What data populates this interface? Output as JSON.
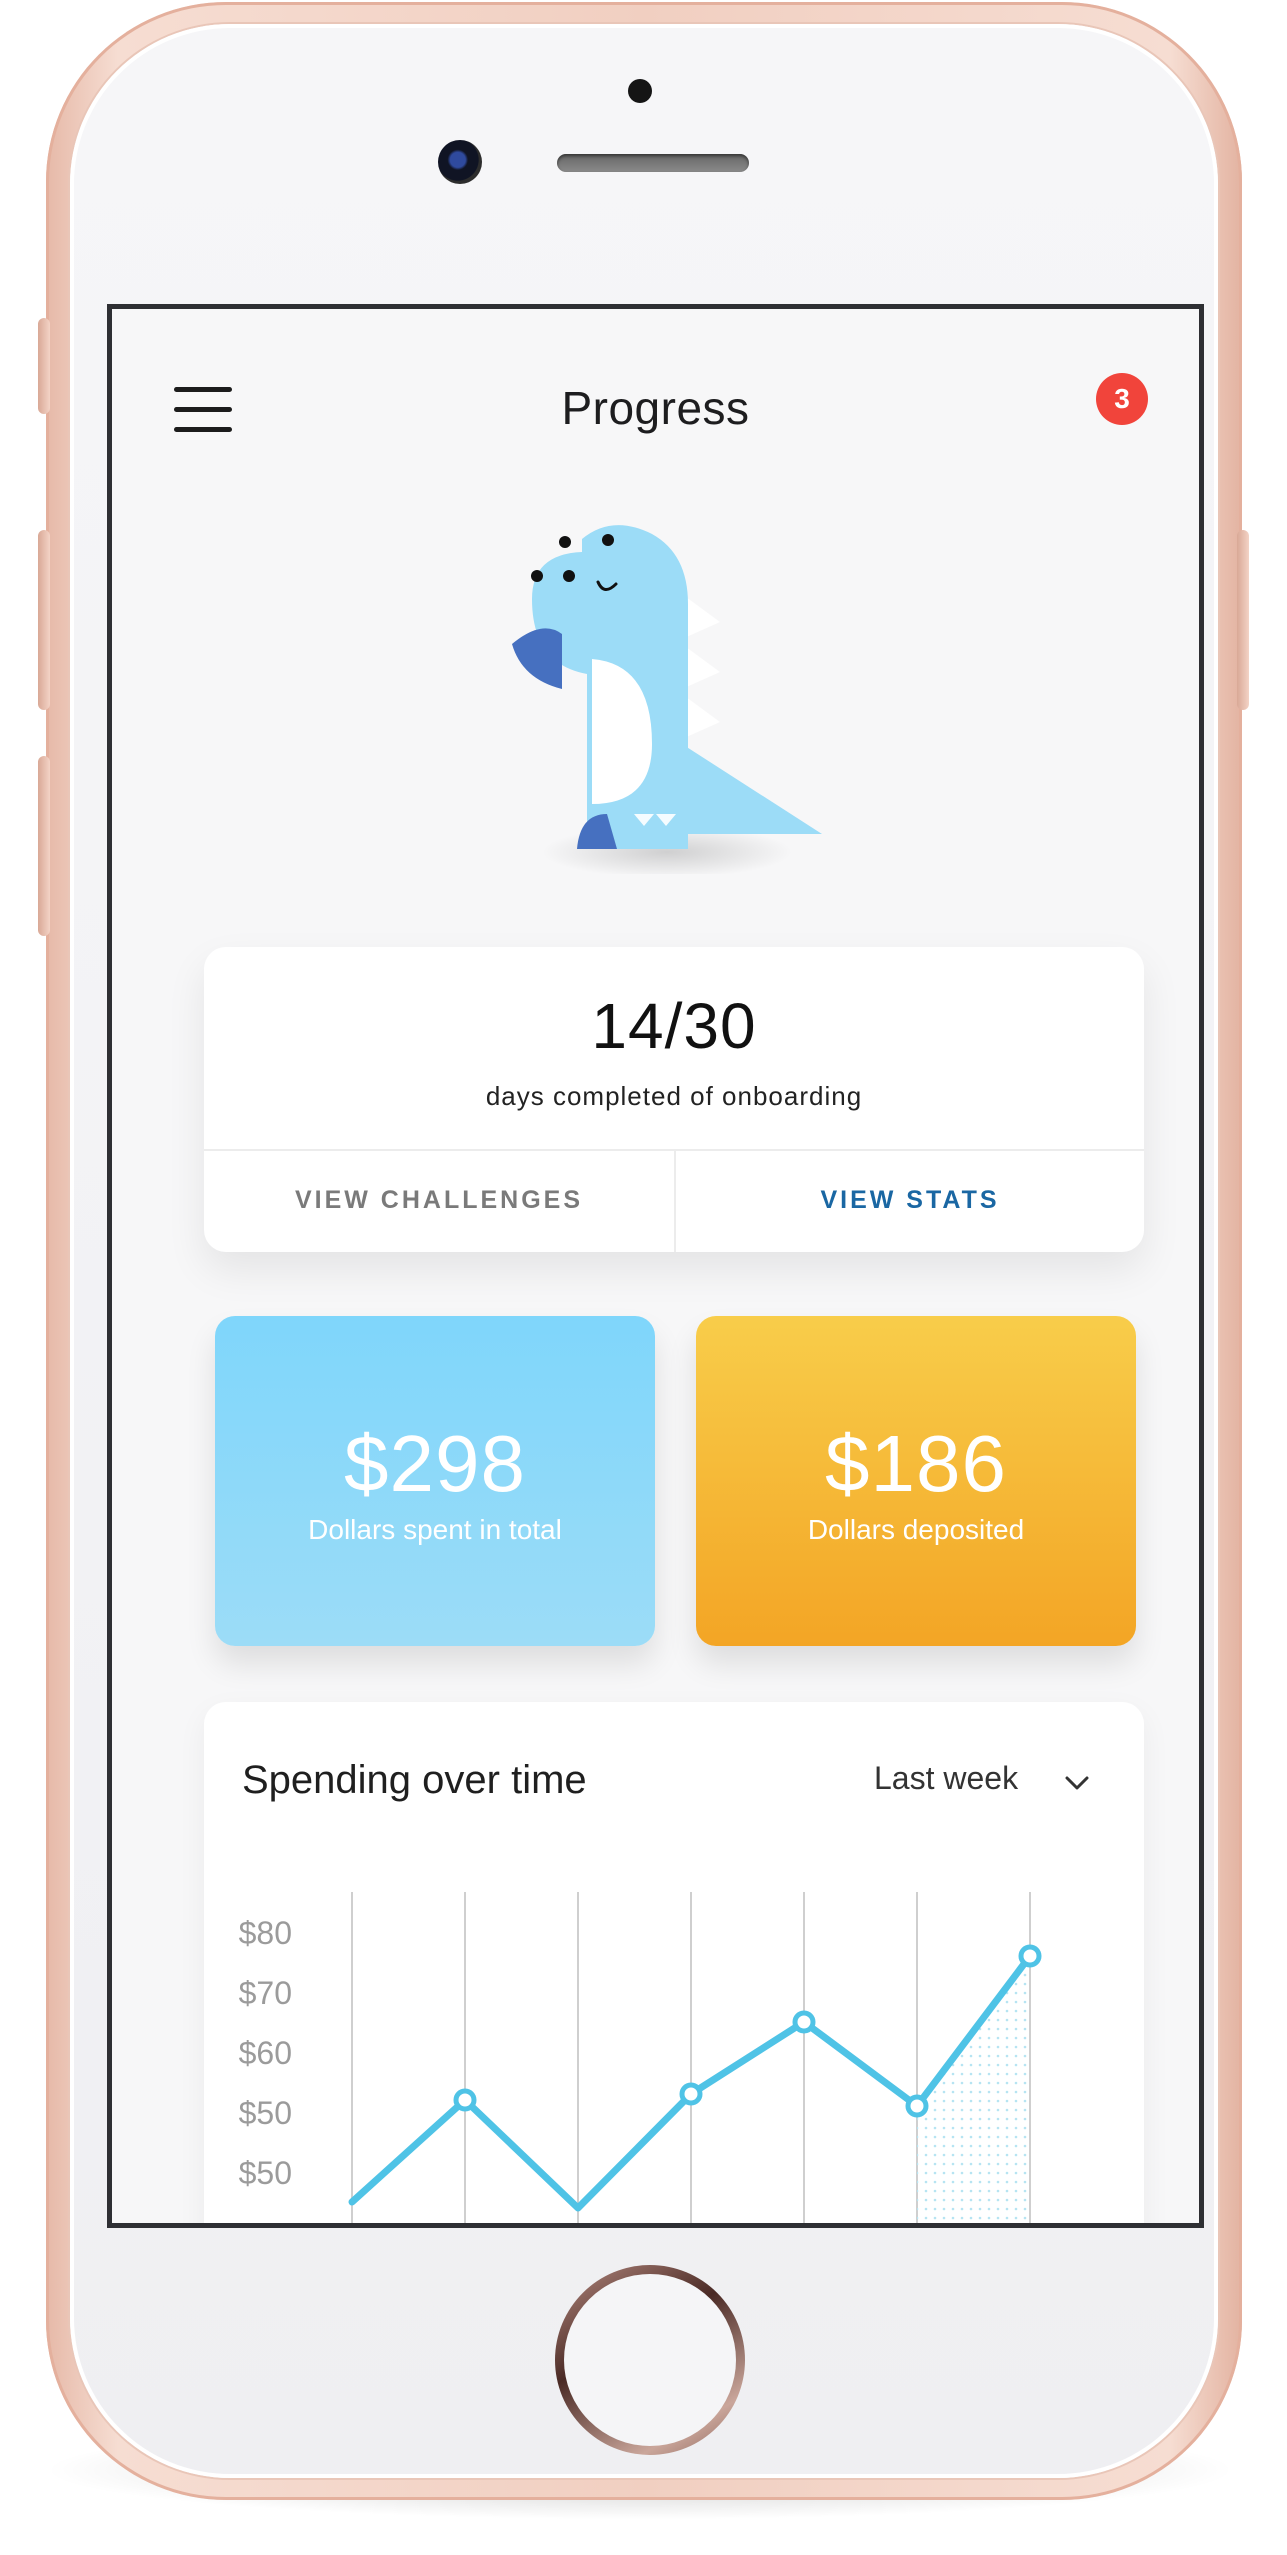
{
  "header": {
    "title": "Progress",
    "notification_count": "3"
  },
  "onboarding": {
    "count": "14/30",
    "caption": "days completed of onboarding",
    "view_challenges_label": "VIEW CHALLENGES",
    "view_stats_label": "VIEW STATS"
  },
  "stats": [
    {
      "value": "$298",
      "label": "Dollars spent in total"
    },
    {
      "value": "$186",
      "label": "Dollars deposited"
    }
  ],
  "spending_chart": {
    "title": "Spending over time",
    "range_label": "Last week"
  },
  "colors": {
    "accent_blue": "#1a67a3",
    "badge_red": "#f1443b",
    "line_blue": "#4fc3e6",
    "tile_blue": "#7fd6fb",
    "tile_orange": "#f3a525"
  },
  "chart_data": {
    "type": "line",
    "ytick_labels": [
      "$80",
      "$70",
      "$60",
      "$50",
      "$50"
    ],
    "ylim": [
      40,
      80
    ],
    "x": [
      1,
      2,
      3,
      4,
      5,
      6,
      7
    ],
    "values": [
      35,
      52,
      34,
      53,
      65,
      51,
      76
    ],
    "grid": true,
    "highlighted_range": [
      6,
      7
    ]
  }
}
